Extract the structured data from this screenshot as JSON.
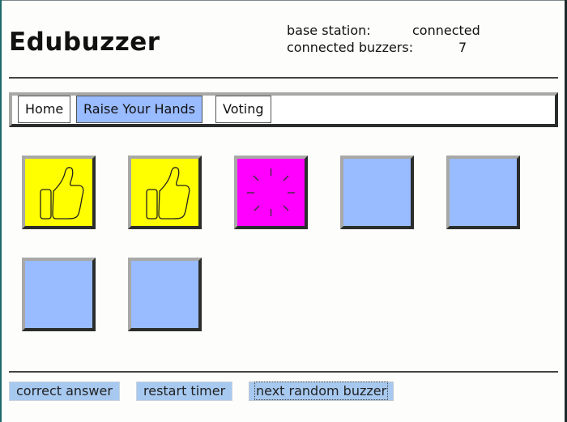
{
  "app": {
    "title": "Edubuzzer"
  },
  "status": {
    "base_station_label": "base station:",
    "base_station_value": "connected",
    "buzzers_label": "connected buzzers:",
    "buzzers_value": "7"
  },
  "tabs": [
    {
      "label": "Home",
      "active": false
    },
    {
      "label": "Raise Your Hands",
      "active": true
    },
    {
      "label": "Voting",
      "active": false
    }
  ],
  "buzzers": [
    {
      "state": "thumbs-up",
      "color": "#ffff00"
    },
    {
      "state": "thumbs-up",
      "color": "#ffff00"
    },
    {
      "state": "flashing",
      "color": "#ff00ff"
    },
    {
      "state": "idle",
      "color": "#99bbff"
    },
    {
      "state": "idle",
      "color": "#99bbff"
    },
    {
      "state": "idle",
      "color": "#99bbff"
    },
    {
      "state": "idle",
      "color": "#99bbff"
    }
  ],
  "actions": {
    "correct_answer": "correct answer",
    "restart_timer": "restart timer",
    "next_random_buzzer": "next random buzzer"
  },
  "colors": {
    "active_tab": "#99bbff",
    "buzzer_idle": "#99bbff",
    "buzzer_answered": "#ffff00",
    "buzzer_selected": "#ff00ff",
    "action_button": "#a7c9f0"
  }
}
